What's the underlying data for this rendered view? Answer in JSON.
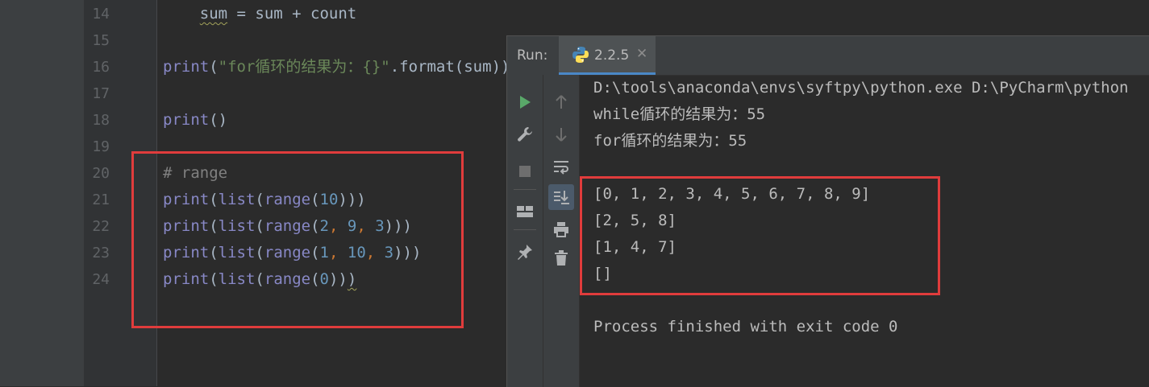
{
  "editor": {
    "lines": [
      {
        "n": "14",
        "segments": [
          {
            "t": "    "
          },
          {
            "t": "sum",
            "c": "squig"
          },
          {
            "t": " = sum + count"
          }
        ]
      },
      {
        "n": "15",
        "segments": []
      },
      {
        "n": "16",
        "segments": [
          {
            "t": "print",
            "c": "fn"
          },
          {
            "t": "("
          },
          {
            "t": "\"for循环的结果为：{}\"",
            "c": "str"
          },
          {
            "t": ".format(sum))"
          }
        ]
      },
      {
        "n": "17",
        "segments": []
      },
      {
        "n": "18",
        "segments": [
          {
            "t": "print",
            "c": "fn"
          },
          {
            "t": "()"
          }
        ]
      },
      {
        "n": "19",
        "segments": []
      },
      {
        "n": "20",
        "segments": [
          {
            "t": "# range",
            "c": "cmt"
          }
        ]
      },
      {
        "n": "21",
        "segments": [
          {
            "t": "print",
            "c": "fn"
          },
          {
            "t": "("
          },
          {
            "t": "list",
            "c": "fn"
          },
          {
            "t": "("
          },
          {
            "t": "range",
            "c": "fn"
          },
          {
            "t": "("
          },
          {
            "t": "10",
            "c": "num"
          },
          {
            "t": ")))"
          }
        ]
      },
      {
        "n": "22",
        "segments": [
          {
            "t": "print",
            "c": "fn"
          },
          {
            "t": "("
          },
          {
            "t": "list",
            "c": "fn"
          },
          {
            "t": "("
          },
          {
            "t": "range",
            "c": "fn"
          },
          {
            "t": "("
          },
          {
            "t": "2",
            "c": "num"
          },
          {
            "t": ", ",
            "c": "punc"
          },
          {
            "t": "9",
            "c": "num"
          },
          {
            "t": ", ",
            "c": "punc"
          },
          {
            "t": "3",
            "c": "num"
          },
          {
            "t": ")))"
          }
        ]
      },
      {
        "n": "23",
        "segments": [
          {
            "t": "print",
            "c": "fn"
          },
          {
            "t": "("
          },
          {
            "t": "list",
            "c": "fn"
          },
          {
            "t": "("
          },
          {
            "t": "range",
            "c": "fn"
          },
          {
            "t": "("
          },
          {
            "t": "1",
            "c": "num"
          },
          {
            "t": ", ",
            "c": "punc"
          },
          {
            "t": "10",
            "c": "num"
          },
          {
            "t": ", ",
            "c": "punc"
          },
          {
            "t": "3",
            "c": "num"
          },
          {
            "t": ")))"
          }
        ]
      },
      {
        "n": "24",
        "segments": [
          {
            "t": "print",
            "c": "fn"
          },
          {
            "t": "("
          },
          {
            "t": "list",
            "c": "fn"
          },
          {
            "t": "("
          },
          {
            "t": "range",
            "c": "fn"
          },
          {
            "t": "("
          },
          {
            "t": "0",
            "c": "num"
          },
          {
            "t": "))"
          },
          {
            "t": ")",
            "c": "squig"
          }
        ]
      }
    ]
  },
  "run_panel": {
    "label": "Run:",
    "tab_label": "2.2.5",
    "close_glyph": "✕",
    "console_lines": [
      "D:\\tools\\anaconda\\envs\\syftpy\\python.exe D:\\PyCharm\\python",
      "while循环的结果为：55",
      "for循环的结果为：55",
      "",
      "[0, 1, 2, 3, 4, 5, 6, 7, 8, 9]",
      "[2, 5, 8]",
      "[1, 4, 7]",
      "[]",
      "",
      "Process finished with exit code 0"
    ]
  },
  "toolbar_icons": {
    "left": [
      "run-icon",
      "wrench-icon",
      "stop-icon",
      "layout-icon",
      "pin-icon"
    ],
    "right": [
      "arrow-up-icon",
      "arrow-down-icon",
      "soft-wrap-icon",
      "scroll-to-end-icon",
      "print-icon",
      "trash-icon"
    ]
  },
  "colors": {
    "highlight_border": "#e03c3c",
    "run_green": "#59a869",
    "tab_underline": "#4a88c7"
  }
}
